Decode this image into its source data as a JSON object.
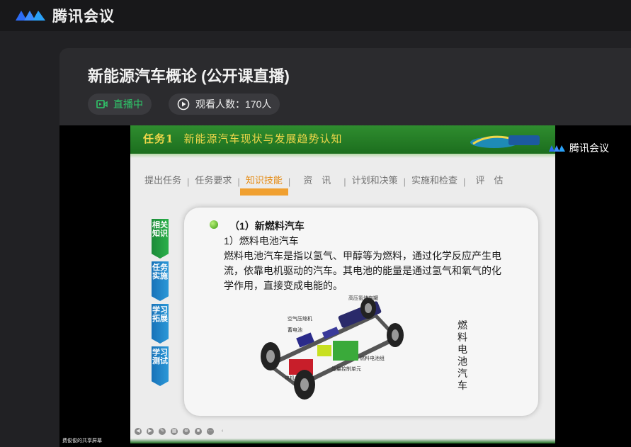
{
  "app": {
    "title": "腾讯会议"
  },
  "room": {
    "title": "新能源汽车概论 (公开课直播)",
    "live_label": "直播中",
    "viewers_label": "观看人数：170人"
  },
  "slide": {
    "task": "任务1",
    "heading": "新能源汽车现状与发展趋势认知",
    "tabs": [
      {
        "label": "提出任务",
        "active": false
      },
      {
        "label": "任务要求",
        "active": false
      },
      {
        "label": "知识技能",
        "active": true
      },
      {
        "label": "资　讯",
        "active": false
      },
      {
        "label": "计划和决策",
        "active": false
      },
      {
        "label": "实施和检查",
        "active": false
      },
      {
        "label": "评　估",
        "active": false
      }
    ],
    "side_buttons": [
      "相关知识",
      "任务实施",
      "学习拓展",
      "学习测试"
    ],
    "point_title": "（1）新燃料汽车",
    "sub_title": "1）燃料电池汽车",
    "paragraph": "燃料电池汽车是指以氢气、甲醇等为燃料，通过化学反应产生电流，依靠电机驱动的汽车。其电池的能量是通过氢气和氧气的化学作用，直接变成电能的。",
    "diagram_labels": {
      "tank": "高压氢储存罐",
      "compressor": "空气压缩机",
      "battery": "蓄电池",
      "fuel_cell": "燃料电池组",
      "control": "能量控制单元",
      "motor": "电机"
    },
    "vertical_title": "燃料电池汽车"
  },
  "overlay": {
    "brand": "腾讯会议"
  },
  "sharer": {
    "label": "费俊俊的共享屏幕"
  },
  "colors": {
    "live_green": "#2fc86a",
    "slide_green": "#1c6e1e",
    "tab_active": "#e58b14"
  }
}
